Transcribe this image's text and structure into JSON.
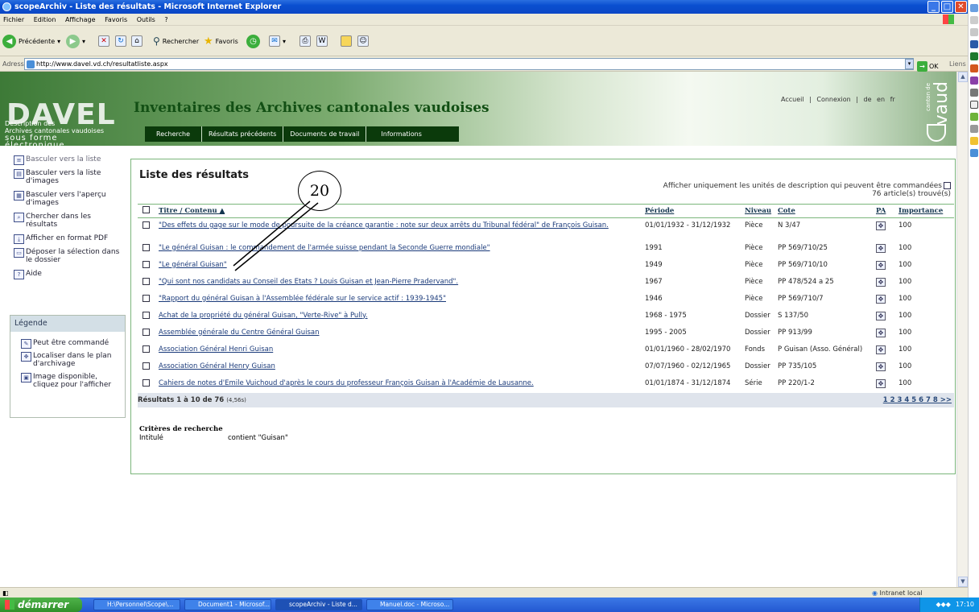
{
  "window": {
    "title": "scopeArchiv - Liste des résultats - Microsoft Internet Explorer"
  },
  "menu": [
    "Fichier",
    "Edition",
    "Affichage",
    "Favoris",
    "Outils",
    "?"
  ],
  "toolbar": {
    "back": "Précédente",
    "search": "Rechercher",
    "favorites": "Favoris"
  },
  "address": {
    "label": "Adresse",
    "url": "http://www.davel.vd.ch/resultatliste.aspx",
    "go": "OK",
    "links": "Liens"
  },
  "header": {
    "logo": "DAVEL",
    "logo_sub1": "Description des",
    "logo_sub2": "Archives cantonales vaudoises",
    "logo_sub3": "sous forme électronique",
    "title": "Inventaires des Archives cantonales vaudoises",
    "top_links": [
      "Accueil",
      "|",
      "Connexion",
      "|",
      "de",
      "en",
      "fr"
    ],
    "nav": [
      "Recherche",
      "Résultats précédents",
      "Documents de travail",
      "Informations"
    ],
    "canton_small": "canton de",
    "canton": "vaud"
  },
  "sidebar": {
    "items": [
      {
        "icon": "list-icon",
        "label": "Basculer vers la liste"
      },
      {
        "icon": "image-list-icon",
        "label": "Basculer vers la liste d'images"
      },
      {
        "icon": "image-preview-icon",
        "label": "Basculer vers l'aperçu d'images"
      },
      {
        "icon": "search-results-icon",
        "label": "Chercher dans les résultats"
      },
      {
        "icon": "pdf-icon",
        "label": "Afficher en format PDF"
      },
      {
        "icon": "folder-icon",
        "label": "Déposer la sélection dans le dossier"
      },
      {
        "icon": "help-icon",
        "label": "Aide"
      }
    ]
  },
  "legend": {
    "title": "Légende",
    "items": [
      {
        "icon": "order-icon",
        "label": "Peut être commandé"
      },
      {
        "icon": "locate-icon",
        "label": "Localiser dans le plan d'archivage"
      },
      {
        "icon": "image-icon",
        "label": "Image disponible, cliquez pour l'afficher"
      }
    ]
  },
  "results": {
    "title": "Liste des résultats",
    "filter_label": "Afficher uniquement les unités de description qui peuvent être commandées",
    "count": "76 article(s) trouvé(s)",
    "columns": [
      "Titre / Contenu ▲",
      "Période",
      "Niveau",
      "Cote",
      "PA",
      "Importance"
    ],
    "rows": [
      {
        "title": "\"Des effets du gage sur le mode de poursuite de la créance garantie : note sur deux arrêts du Tribunal fédéral\" de François Guisan.",
        "period": "01/01/1932 - 31/12/1932",
        "level": "Pièce",
        "cote": "N 3/47",
        "importance": "100"
      },
      {
        "title": "\"Le général Guisan : le commandement de l'armée suisse pendant la Seconde Guerre mondiale\"",
        "period": "1991",
        "level": "Pièce",
        "cote": "PP 569/710/25",
        "importance": "100"
      },
      {
        "title": "\"Le général Guisan\"",
        "period": "1949",
        "level": "Pièce",
        "cote": "PP 569/710/10",
        "importance": "100"
      },
      {
        "title": "\"Qui sont nos candidats au Conseil des Etats ? Louis Guisan et Jean-Pierre Pradervand\".",
        "period": "1967",
        "level": "Pièce",
        "cote": "PP 478/524 a 25",
        "importance": "100"
      },
      {
        "title": "\"Rapport du général Guisan à l'Assemblée fédérale sur le service actif : 1939-1945\"",
        "period": "1946",
        "level": "Pièce",
        "cote": "PP 569/710/7",
        "importance": "100"
      },
      {
        "title": "Achat de la propriété du général Guisan, \"Verte-Rive\" à Pully.",
        "period": "1968 - 1975",
        "level": "Dossier",
        "cote": "S 137/50",
        "importance": "100"
      },
      {
        "title": "Assemblée générale du Centre Général Guisan",
        "period": "1995 - 2005",
        "level": "Dossier",
        "cote": "PP 913/99",
        "importance": "100"
      },
      {
        "title": "Association Général Henri Guisan",
        "period": "01/01/1960 - 28/02/1970",
        "level": "Fonds",
        "cote": "P Guisan (Asso. Général)",
        "importance": "100"
      },
      {
        "title": "Association Général Henry Guisan",
        "period": "07/07/1960 - 02/12/1965",
        "level": "Dossier",
        "cote": "PP 735/105",
        "importance": "100"
      },
      {
        "title": "Cahiers de notes d'Emile Vuichoud d'après le cours du professeur François Guisan à l'Académie de Lausanne.",
        "period": "01/01/1874 - 31/12/1874",
        "level": "Série",
        "cote": "PP 220/1-2",
        "importance": "100"
      }
    ],
    "footer": "Résultats 1 à 10 de 76",
    "timing": "(4,56s)",
    "pages": "1 2 3 4 5 6 7 8 >>"
  },
  "criteria": {
    "title": "Critères de recherche",
    "field": "Intitulé",
    "value": "contient \"Guisan\""
  },
  "callout": "20",
  "status": {
    "zone": "Intranet local"
  },
  "taskbar": {
    "start": "démarrer",
    "tasks": [
      "H:\\Personnel\\Scope\\...",
      "Document1 - Microsof...",
      "scopeArchiv - Liste d...",
      "Manuel.doc - Microso..."
    ],
    "clock": "17:10"
  }
}
